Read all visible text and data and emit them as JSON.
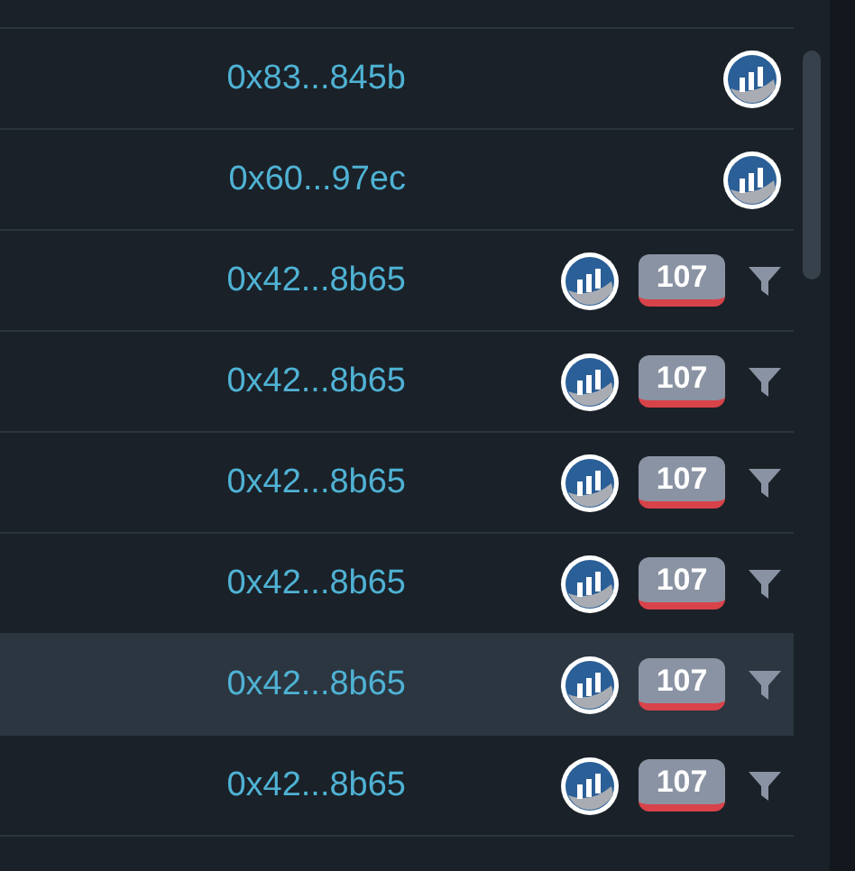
{
  "rows": [
    {
      "kind": "plain",
      "address": "0x83...845b",
      "selected": false
    },
    {
      "kind": "plain",
      "address": "0x60...97ec",
      "selected": false
    },
    {
      "kind": "tagged",
      "address": "0x42...8b65",
      "count": "107",
      "selected": false
    },
    {
      "kind": "tagged",
      "address": "0x42...8b65",
      "count": "107",
      "selected": false
    },
    {
      "kind": "tagged",
      "address": "0x42...8b65",
      "count": "107",
      "selected": false
    },
    {
      "kind": "tagged",
      "address": "0x42...8b65",
      "count": "107",
      "selected": false
    },
    {
      "kind": "tagged",
      "address": "0x42...8b65",
      "count": "107",
      "selected": true
    },
    {
      "kind": "tagged",
      "address": "0x42...8b65",
      "count": "107",
      "selected": false
    }
  ]
}
